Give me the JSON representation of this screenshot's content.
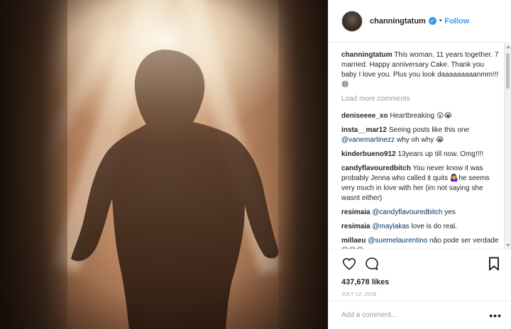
{
  "post": {
    "username": "channingtatum",
    "follow_label": "Follow",
    "separator": "•",
    "verified_glyph": "✓"
  },
  "caption": {
    "username": "channingtatum",
    "text": "This woman. 11 years together. 7 married. Happy anniversary Cake. Thank you baby I love you. Plus you look daaaaaaaaanmm!!!😄"
  },
  "load_more_label": "Load more comments",
  "comments": [
    {
      "username": "deniseeee_xo",
      "text": "Heartbreaking 😮😭"
    },
    {
      "username": "insta__mar12",
      "text": "Seeing posts like this one",
      "mention": "@vanemartinezz",
      "text_after": "why oh why 😭"
    },
    {
      "username": "kinderbueno912",
      "text": "13years up till now. Omg!!!!"
    },
    {
      "username": "candyflavouredbitch",
      "text": "You never know it was probably Jenna who called it quits 🤷‍♀️he seems very much in love with her (im not saying she wasnt either)"
    },
    {
      "username": "resimaia",
      "mention": "@candyflavouredbitch",
      "text_after": "yes"
    },
    {
      "username": "resimaia",
      "mention": "@maylakas",
      "text_after": "love is do real."
    },
    {
      "username": "millaeu",
      "mention": "@suemelaurentino",
      "text_after": "não pode ser verdade 😮😮😮"
    }
  ],
  "icons": {
    "like": "heart-icon",
    "comment": "comment-bubble-icon",
    "save": "bookmark-icon",
    "more": "more-options-icon"
  },
  "likes_text": "437,678 likes",
  "date_text": "JULY 12, 2016",
  "add_comment": {
    "placeholder": "Add a comment...",
    "more_label": "•••"
  },
  "colors": {
    "link_blue": "#3897f0",
    "mention_blue": "#003569",
    "muted_gray": "#999999",
    "border": "#efefef"
  }
}
